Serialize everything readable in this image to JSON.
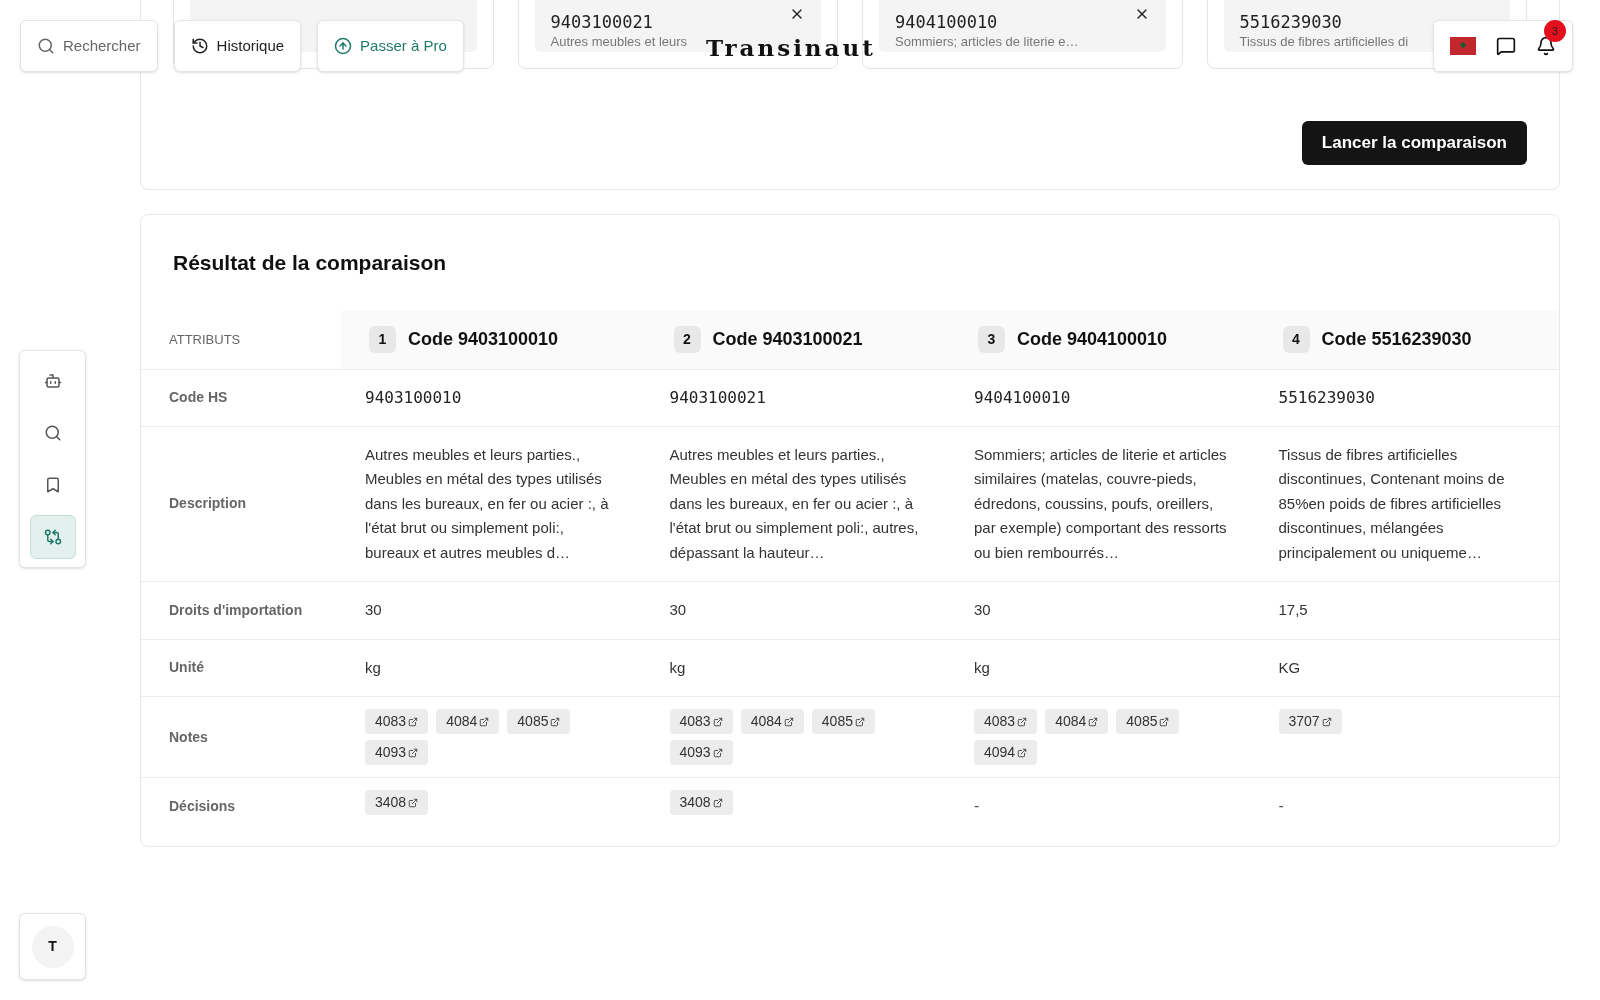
{
  "header": {
    "search": {
      "label": "Rechercher"
    },
    "history": {
      "label": "Historique"
    },
    "upgrade": {
      "label": "Passer à Pro"
    },
    "logo": "Transinaut",
    "notifications": {
      "count": "3"
    }
  },
  "selection": {
    "cards": [
      {
        "closable": false
      },
      {
        "code": "9403100021",
        "description": "Autres meubles et leurs",
        "closable": true
      },
      {
        "code": "9404100010",
        "description": "Sommiers; articles de literie e…",
        "closable": true
      },
      {
        "code": "5516239030",
        "description": "Tissus de fibres artificielles di",
        "closable": false
      }
    ],
    "compare_button": "Lancer la comparaison"
  },
  "result": {
    "title": "Résultat de la comparaison",
    "attributes_heading": "ATTRIBUTS",
    "columns": [
      {
        "index": "1",
        "title": "Code 9403100010"
      },
      {
        "index": "2",
        "title": "Code 9403100021"
      },
      {
        "index": "3",
        "title": "Code 9404100010"
      },
      {
        "index": "4",
        "title": "Code 5516239030"
      }
    ],
    "rows": [
      {
        "label": "Code HS",
        "kind": "mono",
        "cells": [
          "9403100010",
          "9403100021",
          "9404100010",
          "5516239030"
        ]
      },
      {
        "label": "Description",
        "kind": "text",
        "cells": [
          "Autres meubles et leurs parties., Meubles en métal des types utilisés dans les bureaux, en fer ou acier :, à l'état brut ou simplement poli:, bureaux et autres meubles d…",
          "Autres meubles et leurs parties., Meubles en métal des types utilisés dans les bureaux, en fer ou acier :, à l'état brut ou simplement poli:, autres, dépassant la hauteur…",
          "Sommiers; articles de literie et articles similaires (matelas, couvre-pieds, édredons, coussins, poufs, oreillers, par exemple) comportant des ressorts ou bien rembourrés…",
          "Tissus de fibres artificielles discontinues, Contenant moins de 85%en poids de fibres artificielles discontinues, mélangées principalement ou uniqueme…"
        ]
      },
      {
        "label": "Droits d'importation",
        "kind": "text",
        "cells": [
          "30",
          "30",
          "30",
          "17,5"
        ]
      },
      {
        "label": "Unité",
        "kind": "text",
        "cells": [
          "kg",
          "kg",
          "kg",
          "KG"
        ]
      },
      {
        "label": "Notes",
        "kind": "chips",
        "cells": [
          [
            "4083",
            "4084",
            "4085",
            "4093"
          ],
          [
            "4083",
            "4084",
            "4085",
            "4093"
          ],
          [
            "4083",
            "4084",
            "4085",
            "4094"
          ],
          [
            "3707"
          ]
        ]
      },
      {
        "label": "Décisions",
        "kind": "chips",
        "cells": [
          [
            "3408"
          ],
          [
            "3408"
          ],
          "-",
          "-"
        ]
      }
    ]
  },
  "sidebar": {
    "items": [
      {
        "kind": "bot",
        "selected": false
      },
      {
        "kind": "search",
        "selected": false
      },
      {
        "kind": "bookmark",
        "selected": false
      },
      {
        "kind": "compare",
        "selected": true
      }
    ]
  },
  "avatar": {
    "initial": "T"
  }
}
